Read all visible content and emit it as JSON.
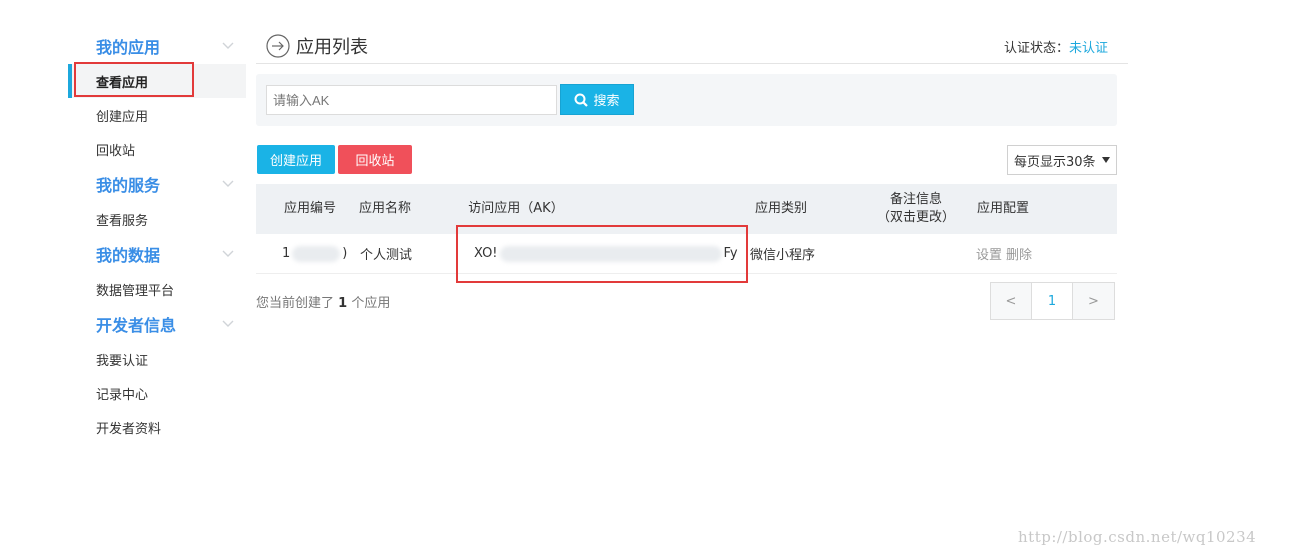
{
  "sidebar": {
    "groups": [
      {
        "title": "我的应用",
        "items": [
          "查看应用",
          "创建应用",
          "回收站"
        ]
      },
      {
        "title": "我的服务",
        "items": [
          "查看服务"
        ]
      },
      {
        "title": "我的数据",
        "items": [
          "数据管理平台"
        ]
      },
      {
        "title": "开发者信息",
        "items": [
          "我要认证",
          "记录中心",
          "开发者资料"
        ]
      }
    ],
    "active_item": "查看应用"
  },
  "header": {
    "title": "应用列表",
    "auth_label": "认证状态：",
    "auth_value": "未认证"
  },
  "search": {
    "placeholder": "请输入AK",
    "button_label": "搜索"
  },
  "actions": {
    "create_label": "创建应用",
    "recycle_label": "回收站",
    "page_size_label": "每页显示30条"
  },
  "table": {
    "columns": [
      "应用编号",
      "应用名称",
      "访问应用（AK）",
      "应用类别",
      "备注信息\n（双击更改）",
      "应用配置"
    ],
    "rows": [
      {
        "id_prefix": "1",
        "id_suffix": ")",
        "name": "个人测试",
        "ak_prefix": "XO!",
        "ak_suffix": "Fy",
        "category": "微信小程序",
        "remark": "",
        "config_settings": "设置",
        "config_delete": "删除"
      }
    ]
  },
  "summary": {
    "prefix": "您当前创建了",
    "count": "1",
    "suffix": "个应用"
  },
  "pagination": {
    "prev": "<",
    "current": "1",
    "next": ">"
  },
  "watermark": "http://blog.csdn.net/wq10234",
  "colors": {
    "accent": "#1ab3e6",
    "danger": "#f0505a",
    "group_title": "#3a8ee6",
    "highlight_box": "#e23a3a"
  }
}
